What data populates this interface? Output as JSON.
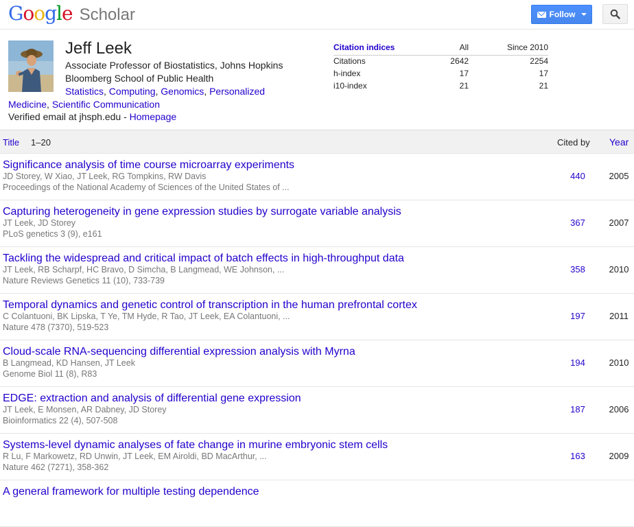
{
  "header": {
    "logo_letters": [
      {
        "ch": "G",
        "color": "#3369e8"
      },
      {
        "ch": "o",
        "color": "#d50f25"
      },
      {
        "ch": "o",
        "color": "#eeb211"
      },
      {
        "ch": "g",
        "color": "#3369e8"
      },
      {
        "ch": "l",
        "color": "#009925"
      },
      {
        "ch": "e",
        "color": "#d50f25"
      }
    ],
    "product": "Scholar",
    "follow_label": "Follow",
    "search_icon": "magnifier-icon",
    "mail_icon": "envelope-icon"
  },
  "profile": {
    "name": "Jeff Leek",
    "affiliation": "Associate Professor of Biostatistics, Johns Hopkins Bloomberg School of Public Health",
    "interests": [
      "Statistics",
      "Computing",
      "Genomics",
      "Personalized Medicine",
      "Scientific Communication"
    ],
    "email_text": "Verified email at jhsph.edu - ",
    "homepage_label": "Homepage"
  },
  "citation_indices": {
    "heading": "Citation indices",
    "col_all": "All",
    "col_since": "Since 2010",
    "rows": [
      {
        "label": "Citations",
        "all": "2642",
        "since": "2254"
      },
      {
        "label": "h-index",
        "all": "17",
        "since": "17"
      },
      {
        "label": "i10-index",
        "all": "21",
        "since": "21"
      }
    ]
  },
  "articles_header": {
    "title_label": "Title",
    "range": "1–20",
    "cited_by_label": "Cited by",
    "year_label": "Year"
  },
  "articles": [
    {
      "title": "Significance analysis of time course microarray experiments",
      "authors": "JD Storey, W Xiao, JT Leek, RG Tompkins, RW Davis",
      "venue": "Proceedings of the National Academy of Sciences of the United States of ...",
      "cited_by": "440",
      "year": "2005"
    },
    {
      "title": "Capturing heterogeneity in gene expression studies by surrogate variable analysis",
      "authors": "JT Leek, JD Storey",
      "venue": "PLoS genetics 3 (9), e161",
      "cited_by": "367",
      "year": "2007"
    },
    {
      "title": "Tackling the widespread and critical impact of batch effects in high-throughput data",
      "authors": "JT Leek, RB Scharpf, HC Bravo, D Simcha, B Langmead, WE Johnson, ...",
      "venue": "Nature Reviews Genetics 11 (10), 733-739",
      "cited_by": "358",
      "year": "2010"
    },
    {
      "title": "Temporal dynamics and genetic control of transcription in the human prefrontal cortex",
      "authors": "C Colantuoni, BK Lipska, T Ye, TM Hyde, R Tao, JT Leek, EA Colantuoni, ...",
      "venue": "Nature 478 (7370), 519-523",
      "cited_by": "197",
      "year": "2011"
    },
    {
      "title": "Cloud-scale RNA-sequencing differential expression analysis with Myrna",
      "authors": "B Langmead, KD Hansen, JT Leek",
      "venue": "Genome Biol 11 (8), R83",
      "cited_by": "194",
      "year": "2010"
    },
    {
      "title": "EDGE: extraction and analysis of differential gene expression",
      "authors": "JT Leek, E Monsen, AR Dabney, JD Storey",
      "venue": "Bioinformatics 22 (4), 507-508",
      "cited_by": "187",
      "year": "2006"
    },
    {
      "title": "Systems-level dynamic analyses of fate change in murine embryonic stem cells",
      "authors": "R Lu, F Markowetz, RD Unwin, JT Leek, EM Airoldi, BD MacArthur, ...",
      "venue": "Nature 462 (7271), 358-362",
      "cited_by": "163",
      "year": "2009"
    },
    {
      "title": "A general framework for multiple testing dependence",
      "authors": "",
      "venue": "",
      "cited_by": "",
      "year": ""
    }
  ]
}
